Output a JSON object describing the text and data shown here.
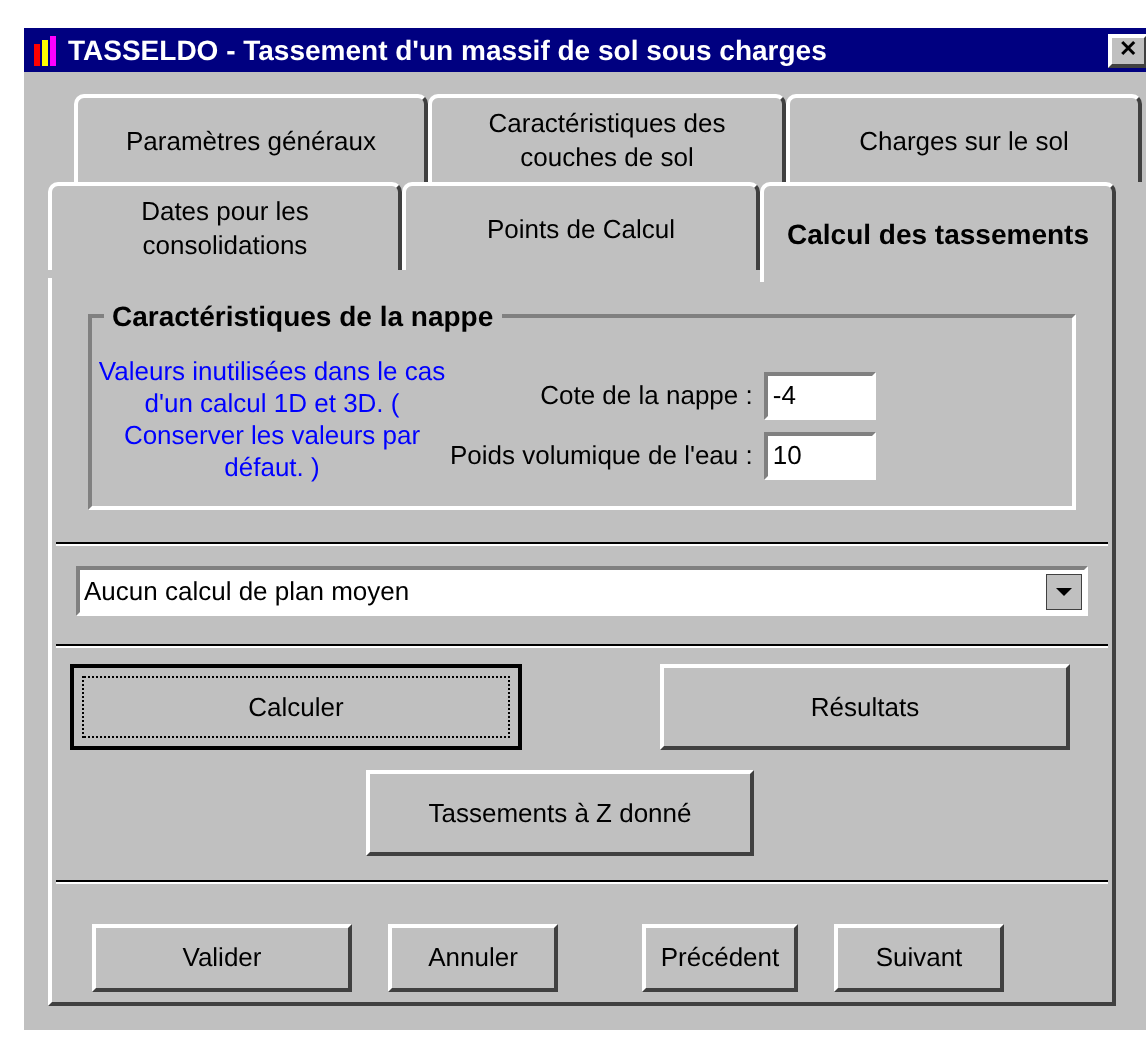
{
  "window": {
    "title": "TASSELDO - Tassement d'un massif de sol sous charges",
    "close": "✕"
  },
  "tab_rows": [
    [
      {
        "label": "Paramètres généraux",
        "selected": false
      },
      {
        "label": "Caractéristiques des couches de sol",
        "selected": false
      },
      {
        "label": "Charges sur le sol",
        "selected": false
      }
    ],
    [
      {
        "label": "Dates pour les consolidations",
        "selected": false
      },
      {
        "label": "Points de Calcul",
        "selected": false
      },
      {
        "label": "Calcul des tassements",
        "selected": true
      }
    ]
  ],
  "nappe": {
    "title": "Caractéristiques de la nappe",
    "note": "Valeurs inutilisées dans le cas d'un calcul 1D et 3D. ( Conserver les valeurs par défaut. )",
    "fields": [
      {
        "label": "Cote de la nappe :",
        "value": "-4"
      },
      {
        "label": "Poids volumique de l'eau :",
        "value": "10"
      }
    ]
  },
  "plan_moyen": {
    "value": "Aucun calcul de plan moyen"
  },
  "actions": [
    {
      "label": "Calculer",
      "focused": true
    },
    {
      "label": "Résultats",
      "focused": false
    },
    {
      "label": "Tassements à Z donné",
      "focused": false
    }
  ],
  "buttons": [
    "Valider",
    "Annuler",
    "Précédent",
    "Suivant"
  ]
}
